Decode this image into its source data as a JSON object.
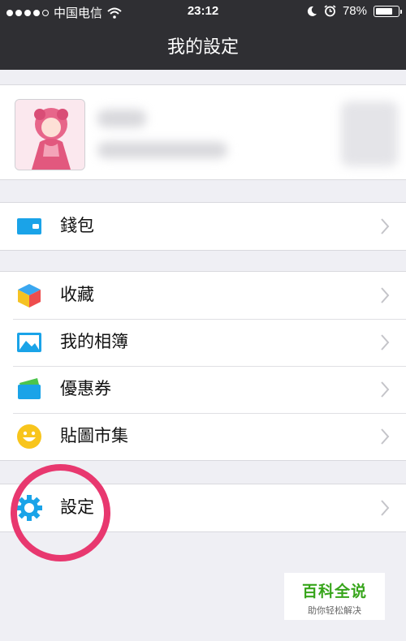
{
  "status_bar": {
    "carrier": "中国电信",
    "time": "23:12",
    "battery": "78%",
    "battery_level": 0.78,
    "signal_bars_filled": 4,
    "signal_bars_total": 5
  },
  "nav": {
    "title": "我的設定"
  },
  "groups": [
    {
      "items": [
        {
          "label": "錢包",
          "icon": "wallet-icon"
        }
      ]
    },
    {
      "items": [
        {
          "label": "收藏",
          "icon": "favorites-cube-icon"
        },
        {
          "label": "我的相簿",
          "icon": "album-image-icon"
        },
        {
          "label": "優惠券",
          "icon": "coupon-icon"
        },
        {
          "label": "貼圖市集",
          "icon": "smiley-sticker-icon"
        }
      ]
    },
    {
      "items": [
        {
          "label": "設定",
          "icon": "gear-icon"
        }
      ]
    }
  ],
  "watermark": {
    "title": "百科全说",
    "subtitle": "助你轻松解决"
  },
  "colors": {
    "nav_bg": "#2f2f33",
    "annotation": "#e8386f",
    "icon_blue": "#1aa3e8",
    "watermark_green": "#37a51b"
  }
}
